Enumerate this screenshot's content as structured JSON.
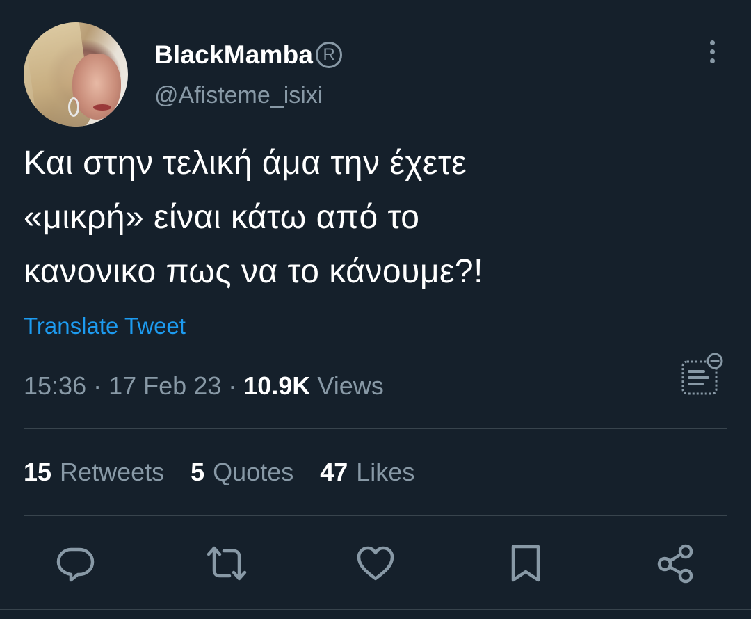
{
  "user": {
    "display_name": "BlackMamba",
    "badge_symbol": "R",
    "handle": "@Afisteme_isixi"
  },
  "tweet": {
    "lines": [
      "Και στην τελική άμα την έχετε",
      "«μικρή» είναι κάτω από το",
      "κανονικο πως να το κάνουμε?!"
    ],
    "translate_label": "Translate Tweet",
    "time": "15:36",
    "separator": "·",
    "date": "17 Feb 23",
    "views_count": "10.9K",
    "views_label": "Views"
  },
  "stats": {
    "retweets_count": "15",
    "retweets_label": "Retweets",
    "quotes_count": "5",
    "quotes_label": "Quotes",
    "likes_count": "47",
    "likes_label": "Likes"
  },
  "icons": {
    "more": "more-vertical-icon",
    "analytics": "analytics-icon",
    "reply": "reply-icon",
    "retweet": "retweet-icon",
    "like": "heart-icon",
    "bookmark": "bookmark-icon",
    "share": "share-icon"
  },
  "colors": {
    "background": "#15202b",
    "text": "#ffffff",
    "secondary_text": "#8899a6",
    "link": "#1d9bf0",
    "divider": "#38444d"
  }
}
